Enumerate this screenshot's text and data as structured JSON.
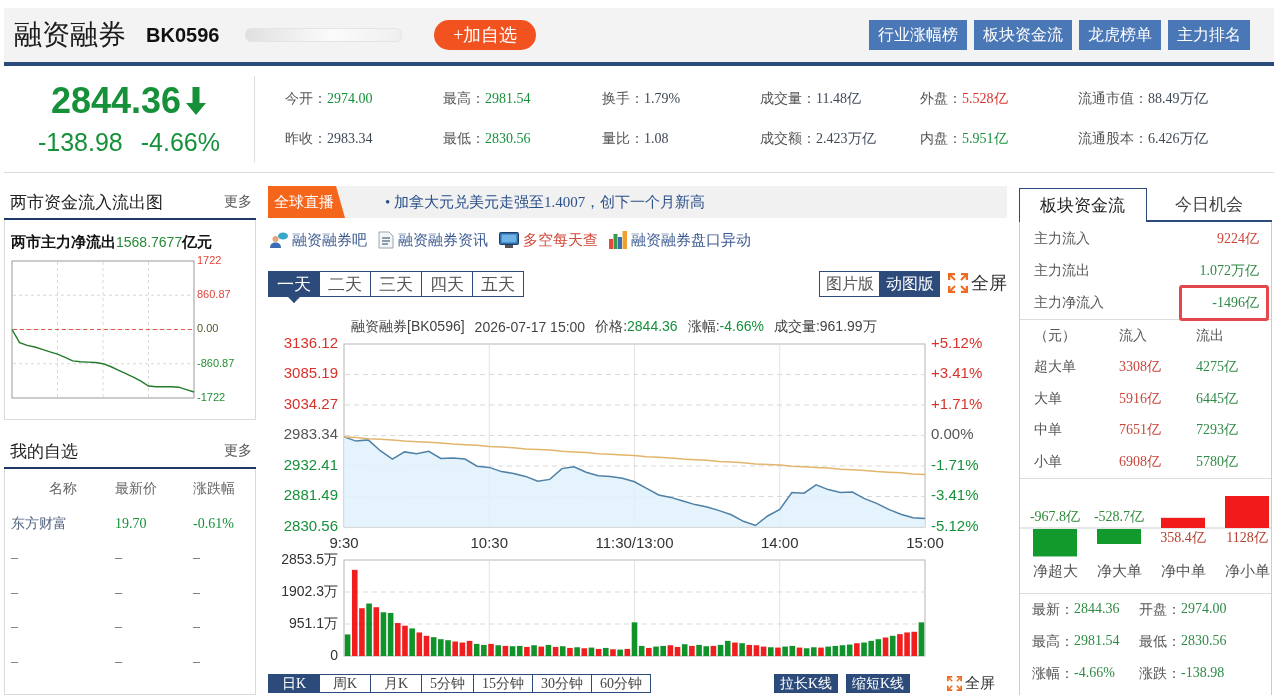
{
  "header": {
    "title": "融资融券",
    "code": "BK0596",
    "add_button": "+加自选",
    "nav_buttons": [
      "行业涨幅榜",
      "板块资金流",
      "龙虎榜单",
      "主力排名"
    ]
  },
  "quote": {
    "price": "2844.36",
    "falling": true,
    "change": "-138.98",
    "change_percent": "-4.66%",
    "stats": [
      {
        "label": "今开：",
        "value": "2974.00",
        "color": "#16913a"
      },
      {
        "label": "最高：",
        "value": "2981.54",
        "color": "#16913a"
      },
      {
        "label": "换手：",
        "value": "1.79%",
        "color": "#3e4957"
      },
      {
        "label": "成交量：",
        "value": "11.48亿",
        "color": "#3e4957"
      },
      {
        "label": "外盘：",
        "value": "5.528亿",
        "color": "#d8322b"
      },
      {
        "label": "流通市值：",
        "value": "88.49万亿",
        "color": "#3e4957"
      },
      {
        "label": "昨收：",
        "value": "2983.34",
        "color": "#3e4957"
      },
      {
        "label": "最低：",
        "value": "2830.56",
        "color": "#16913a"
      },
      {
        "label": "量比：",
        "value": "1.08",
        "color": "#3e4957"
      },
      {
        "label": "成交额：",
        "value": "2.423万亿",
        "color": "#3e4957"
      },
      {
        "label": "内盘：",
        "value": "5.951亿",
        "color": "#16913a"
      },
      {
        "label": "流通股本：",
        "value": "6.426万亿",
        "color": "#3e4957"
      }
    ]
  },
  "market_flow": {
    "title": "两市资金流入流出图",
    "more": "更多",
    "headline": {
      "label": "两市主力净流出",
      "value": "1568.7677",
      "unit": "亿元"
    },
    "chart_data": {
      "type": "line",
      "grid": true,
      "categories": [
        null,
        null,
        null,
        null,
        null,
        null,
        null,
        null,
        null,
        null,
        null,
        null,
        null,
        null,
        null,
        null,
        null,
        null,
        null,
        null,
        null,
        null,
        null,
        null,
        null
      ],
      "series": [
        {
          "color": "#237a2a",
          "values": [
            0,
            -330,
            -400,
            -440,
            -500,
            -560,
            -620,
            -700,
            -790,
            -810,
            -820,
            -830,
            -860,
            -930,
            -1020,
            -1110,
            -1200,
            -1300,
            -1420,
            -1440,
            -1440,
            -1440,
            -1450,
            -1510,
            -1570
          ]
        }
      ],
      "ylim": [
        -1722,
        1722
      ],
      "yticks": [
        {
          "value": 1722,
          "label": "1722"
        },
        {
          "value": 860.87,
          "label": "860.87"
        },
        {
          "value": 0,
          "label": "0.00"
        },
        {
          "value": -860.87,
          "label": "-860.87"
        },
        {
          "value": -1722,
          "label": "-1722"
        }
      ],
      "ref_lines": [
        {
          "axis": "y",
          "value": 0,
          "color": "#e05a4a"
        }
      ]
    }
  },
  "watchlist": {
    "title": "我的自选",
    "more": "更多",
    "columns": [
      "名称",
      "最新价",
      "涨跌幅"
    ],
    "rows": [
      {
        "cells": [
          "东方财富",
          "19.70",
          "-0.61%"
        ],
        "color": "#16913a"
      },
      {
        "cells": [
          "–",
          "–",
          "–"
        ]
      },
      {
        "cells": [
          "–",
          "–",
          "–"
        ]
      },
      {
        "cells": [
          "–",
          "–",
          "–"
        ]
      },
      {
        "cells": [
          "–",
          "–",
          "–"
        ]
      }
    ]
  },
  "ticker": {
    "tag": "全球直播",
    "text": "• 加拿大元兑美元走强至1.4007，创下一个月新高"
  },
  "links": [
    {
      "label": "融资融券吧",
      "highlighted": false
    },
    {
      "label": "融资融券资讯",
      "highlighted": false
    },
    {
      "label": "多空每天查",
      "highlighted": true
    },
    {
      "label": "融资融券盘口异动",
      "highlighted": false
    }
  ],
  "period_tabs": [
    {
      "label": "一天",
      "selected": true
    },
    {
      "label": "二天",
      "selected": false
    },
    {
      "label": "三天",
      "selected": false
    },
    {
      "label": "四天",
      "selected": false
    },
    {
      "label": "五天",
      "selected": false
    }
  ],
  "view_modes": [
    {
      "label": "图片版",
      "selected": false
    },
    {
      "label": "动图版",
      "selected": true
    }
  ],
  "fullscreen": "全屏",
  "price_chart": {
    "summary": {
      "name": "融资融券[BK0596]",
      "time": "2026-07-17 15:00",
      "fields": [
        {
          "label": "价格:",
          "value": "2844.36",
          "color": "#16913a"
        },
        {
          "label": "涨幅:",
          "value": "-4.66%",
          "color": "#16913a"
        },
        {
          "label": "成交量:",
          "value": "961.99万",
          "color": "#444444"
        }
      ]
    },
    "percent_axis": [
      "+5.12%",
      "+3.41%",
      "+1.71%",
      "0.00%",
      "-1.71%",
      "-3.41%",
      "-5.12%"
    ],
    "chart_data": {
      "type": "line",
      "grid": true,
      "categories": [
        "9:30",
        null,
        null,
        null,
        null,
        null,
        null,
        null,
        null,
        null,
        null,
        null,
        "10:30",
        null,
        null,
        null,
        null,
        null,
        null,
        null,
        null,
        null,
        null,
        null,
        "11:30/13:00",
        null,
        null,
        null,
        null,
        null,
        null,
        null,
        null,
        null,
        null,
        null,
        "14:00",
        null,
        null,
        null,
        null,
        null,
        null,
        null,
        null,
        null,
        null,
        null,
        "15:00"
      ],
      "series": [
        {
          "type": "area",
          "color": "#4f80a6",
          "values": [
            2981,
            2974,
            2976,
            2958,
            2944,
            2956,
            2953,
            2957,
            2945,
            2946,
            2944,
            2932,
            2930,
            2923,
            2920,
            2915,
            2907,
            2910,
            2928,
            2931,
            2922,
            2916,
            2915,
            2912,
            2906,
            2895,
            2884,
            2880,
            2874,
            2868,
            2864,
            2858,
            2851,
            2840,
            2833,
            2849,
            2860,
            2888,
            2887,
            2901,
            2893,
            2888,
            2889,
            2878,
            2870,
            2860,
            2852,
            2846,
            2845
          ]
        },
        {
          "color": "#e3b46c",
          "values": [
            2981,
            2980,
            2978,
            2977,
            2976,
            2974,
            2973,
            2972,
            2971,
            2969,
            2968,
            2967,
            2965,
            2964,
            2963,
            2961,
            2960,
            2959,
            2957,
            2956,
            2955,
            2953,
            2952,
            2951,
            2950,
            2948,
            2947,
            2946,
            2944,
            2943,
            2942,
            2940,
            2939,
            2938,
            2936,
            2935,
            2934,
            2932,
            2931,
            2930,
            2929,
            2927,
            2926,
            2925,
            2923,
            2922,
            2921,
            2919,
            2918
          ]
        }
      ],
      "ylim": [
        2830.56,
        3136.12
      ],
      "yticks": [
        {
          "value": 3136.12,
          "label": "3136.12"
        },
        {
          "value": 3085.19,
          "label": "3085.19"
        },
        {
          "value": 3034.27,
          "label": "3034.27"
        },
        {
          "value": 2983.34,
          "label": "2983.34"
        },
        {
          "value": 2932.41,
          "label": "2932.41"
        },
        {
          "value": 2881.49,
          "label": "2881.49"
        },
        {
          "value": 2830.56,
          "label": "2830.56"
        }
      ]
    }
  },
  "volume_chart": {
    "chart_data": {
      "type": "bar",
      "grid": true,
      "categories": [
        null,
        null,
        null,
        null,
        null,
        null,
        null,
        null,
        null,
        null,
        null,
        null,
        null,
        null,
        null,
        null,
        null,
        null,
        null,
        null,
        null,
        null,
        null,
        null,
        null,
        null,
        null,
        null,
        null,
        null,
        null,
        null,
        null,
        null,
        null,
        null,
        null,
        null,
        null,
        null,
        null,
        null,
        null,
        null,
        null,
        null,
        null,
        null,
        null,
        null,
        null,
        null,
        null,
        null,
        null,
        null,
        null,
        null,
        null,
        null,
        null,
        null,
        null,
        null,
        null,
        null,
        null,
        null,
        null,
        null,
        null,
        null,
        null,
        null,
        null,
        null,
        null,
        null,
        null,
        null,
        null
      ],
      "series": [
        {
          "color": "#f01f1f",
          "values": [
            0,
            2560,
            1420,
            0,
            1450,
            0,
            0,
            980,
            900,
            0,
            700,
            600,
            0,
            0,
            0,
            430,
            400,
            450,
            0,
            0,
            360,
            0,
            300,
            0,
            0,
            270,
            0,
            280,
            0,
            270,
            0,
            240,
            0,
            230,
            0,
            210,
            0,
            200,
            0,
            210,
            0,
            0,
            240,
            0,
            0,
            320,
            270,
            0,
            300,
            0,
            0,
            300,
            0,
            0,
            400,
            0,
            330,
            320,
            280,
            0,
            250,
            0,
            0,
            250,
            0,
            0,
            250,
            0,
            0,
            0,
            0,
            380,
            0,
            0,
            0,
            550,
            0,
            650,
            700,
            720,
            0
          ]
        },
        {
          "color": "#11932b",
          "values": [
            640,
            0,
            0,
            1560,
            0,
            1300,
            1280,
            0,
            0,
            820,
            0,
            0,
            560,
            500,
            470,
            0,
            0,
            0,
            360,
            330,
            0,
            320,
            0,
            290,
            300,
            0,
            320,
            0,
            330,
            0,
            290,
            0,
            260,
            0,
            250,
            0,
            240,
            0,
            190,
            0,
            1000,
            300,
            0,
            280,
            300,
            0,
            0,
            350,
            0,
            330,
            290,
            0,
            330,
            450,
            0,
            380,
            0,
            0,
            0,
            260,
            0,
            280,
            300,
            0,
            230,
            260,
            0,
            280,
            300,
            320,
            340,
            0,
            400,
            450,
            500,
            0,
            600,
            0,
            0,
            0,
            1000
          ]
        }
      ],
      "ylim": [
        0,
        2853.5
      ],
      "yticks": [
        {
          "value": 2853.5,
          "label": "2853.5万"
        },
        {
          "value": 1902.3,
          "label": "1902.3万"
        },
        {
          "value": 951.1,
          "label": "951.1万"
        },
        {
          "value": 0,
          "label": "0"
        }
      ]
    }
  },
  "kline_tabs": [
    {
      "label": "日K",
      "selected": true
    },
    {
      "label": "周K",
      "selected": false
    },
    {
      "label": "月K",
      "selected": false
    },
    {
      "label": "5分钟",
      "selected": false
    },
    {
      "label": "15分钟",
      "selected": false
    },
    {
      "label": "30分钟",
      "selected": false
    },
    {
      "label": "60分钟",
      "selected": false
    }
  ],
  "kline_buttons": [
    "拉长K线",
    "缩短K线"
  ],
  "kline_fullscreen": "全屏",
  "sector_flow": {
    "tabs": [
      {
        "label": "板块资金流",
        "selected": true
      },
      {
        "label": "今日机会",
        "selected": false
      }
    ],
    "summary": [
      {
        "label": "主力流入",
        "value": "9224亿",
        "color": "#c8463a",
        "highlighted": false
      },
      {
        "label": "主力流出",
        "value": "1.072万亿",
        "color": "#2f8a46",
        "highlighted": false
      },
      {
        "label": "主力净流入",
        "value": "-1496亿",
        "color": "#2f8a46",
        "highlighted": true
      }
    ],
    "table": {
      "columns": [
        {
          "label": "（元）"
        },
        {
          "label": "流入",
          "color": "#c8463a"
        },
        {
          "label": "流出",
          "color": "#2f8a46"
        }
      ],
      "rows": [
        [
          "超大单",
          "3308亿",
          "4275亿"
        ],
        [
          "大单",
          "5916亿",
          "6445亿"
        ],
        [
          "中单",
          "7651亿",
          "7293亿"
        ],
        [
          "小单",
          "6908亿",
          "5780亿"
        ]
      ]
    },
    "net_chart": {
      "chart_data": {
        "type": "bar",
        "categories": [
          "净超大",
          "净大单",
          "净中单",
          "净小单"
        ],
        "values": [
          -967.8,
          -528.7,
          358.4,
          1128
        ],
        "value_labels": [
          "-967.8亿",
          "-528.7亿",
          "358.4亿",
          "1128亿"
        ]
      }
    },
    "quote_rows": [
      [
        {
          "label": "最新：",
          "value": "2844.36",
          "color": "#2f8a46"
        },
        {
          "label": "开盘：",
          "value": "2974.00",
          "color": "#2f8a46"
        }
      ],
      [
        {
          "label": "最高：",
          "value": "2981.54",
          "color": "#2f8a46"
        },
        {
          "label": "最低：",
          "value": "2830.56",
          "color": "#2f8a46"
        }
      ],
      [
        {
          "label": "涨幅：",
          "value": "-4.66%",
          "color": "#2f8a46"
        },
        {
          "label": "涨跌：",
          "value": "-138.98",
          "color": "#2f8a46"
        }
      ]
    ]
  }
}
